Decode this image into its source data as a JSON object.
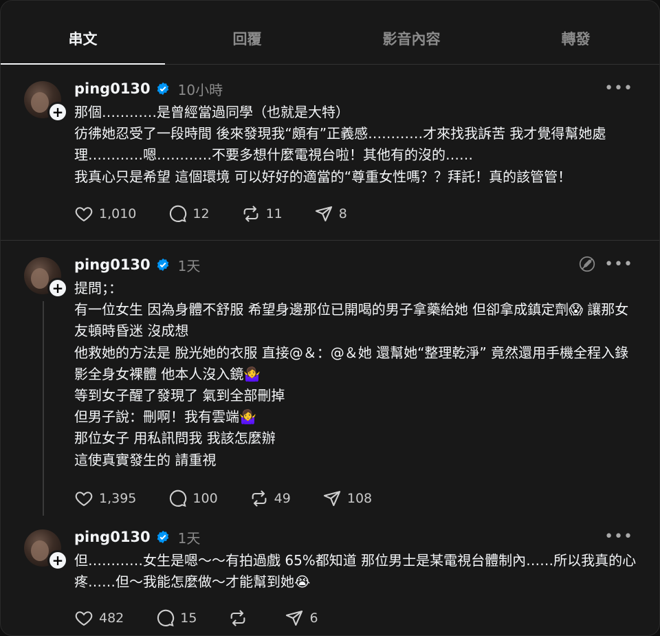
{
  "tabs": [
    {
      "label": "串文",
      "active": true
    },
    {
      "label": "回覆",
      "active": false
    },
    {
      "label": "影音內容",
      "active": false
    },
    {
      "label": "轉發",
      "active": false
    }
  ],
  "colors": {
    "background": "#181818",
    "verified": "#0095f6",
    "muted": "#8b8b8b"
  },
  "posts": [
    {
      "username": "ping0130",
      "time": "10小時",
      "text": "那個…………是曾經當過同學（也就是大特）\n彷彿她忍受了一段時間 後來發現我“頗有”正義感…………才來找我訴苦 我才覺得幫她處理…………嗯…………不要多想什麼電視台啦！其他有的沒的……\n我真心只是希望 這個環境 可以好好的適當的“尊重女性嗎？？拜託！真的該管管！",
      "likes": "1,010",
      "comments": "12",
      "reposts": "11",
      "shares": "8"
    },
    {
      "username": "ping0130",
      "time": "1天",
      "text": "提問；：\n有一位女生 因為身體不舒服 希望身邊那位已開喝的男子拿藥給她 但卻拿成鎮定劑😱 讓那女友頓時昏迷 沒成想\n他救她的方法是 脫光她的衣服 直接@＆：@＆她 還幫她“整理乾淨” 竟然還用手機全程入錄影全身女裸體 他本人沒入鏡🤷‍♀️\n等到女子醒了發現了 氣到全部刪掉\n但男子說：刪啊！我有雲端🤷‍♀️\n那位女子 用私訊問我 我該怎麼辦\n這使真實發生的 請重視",
      "likes": "1,395",
      "comments": "100",
      "reposts": "49",
      "shares": "108"
    },
    {
      "username": "ping0130",
      "time": "1天",
      "text": "但…………女生是嗯～～有拍過戲 65%都知道 那位男士是某電視台體制內……所以我真的心疼……但～我能怎麼做～才能幫到她😭",
      "likes": "482",
      "comments": "15",
      "reposts": "",
      "shares": "6"
    }
  ]
}
